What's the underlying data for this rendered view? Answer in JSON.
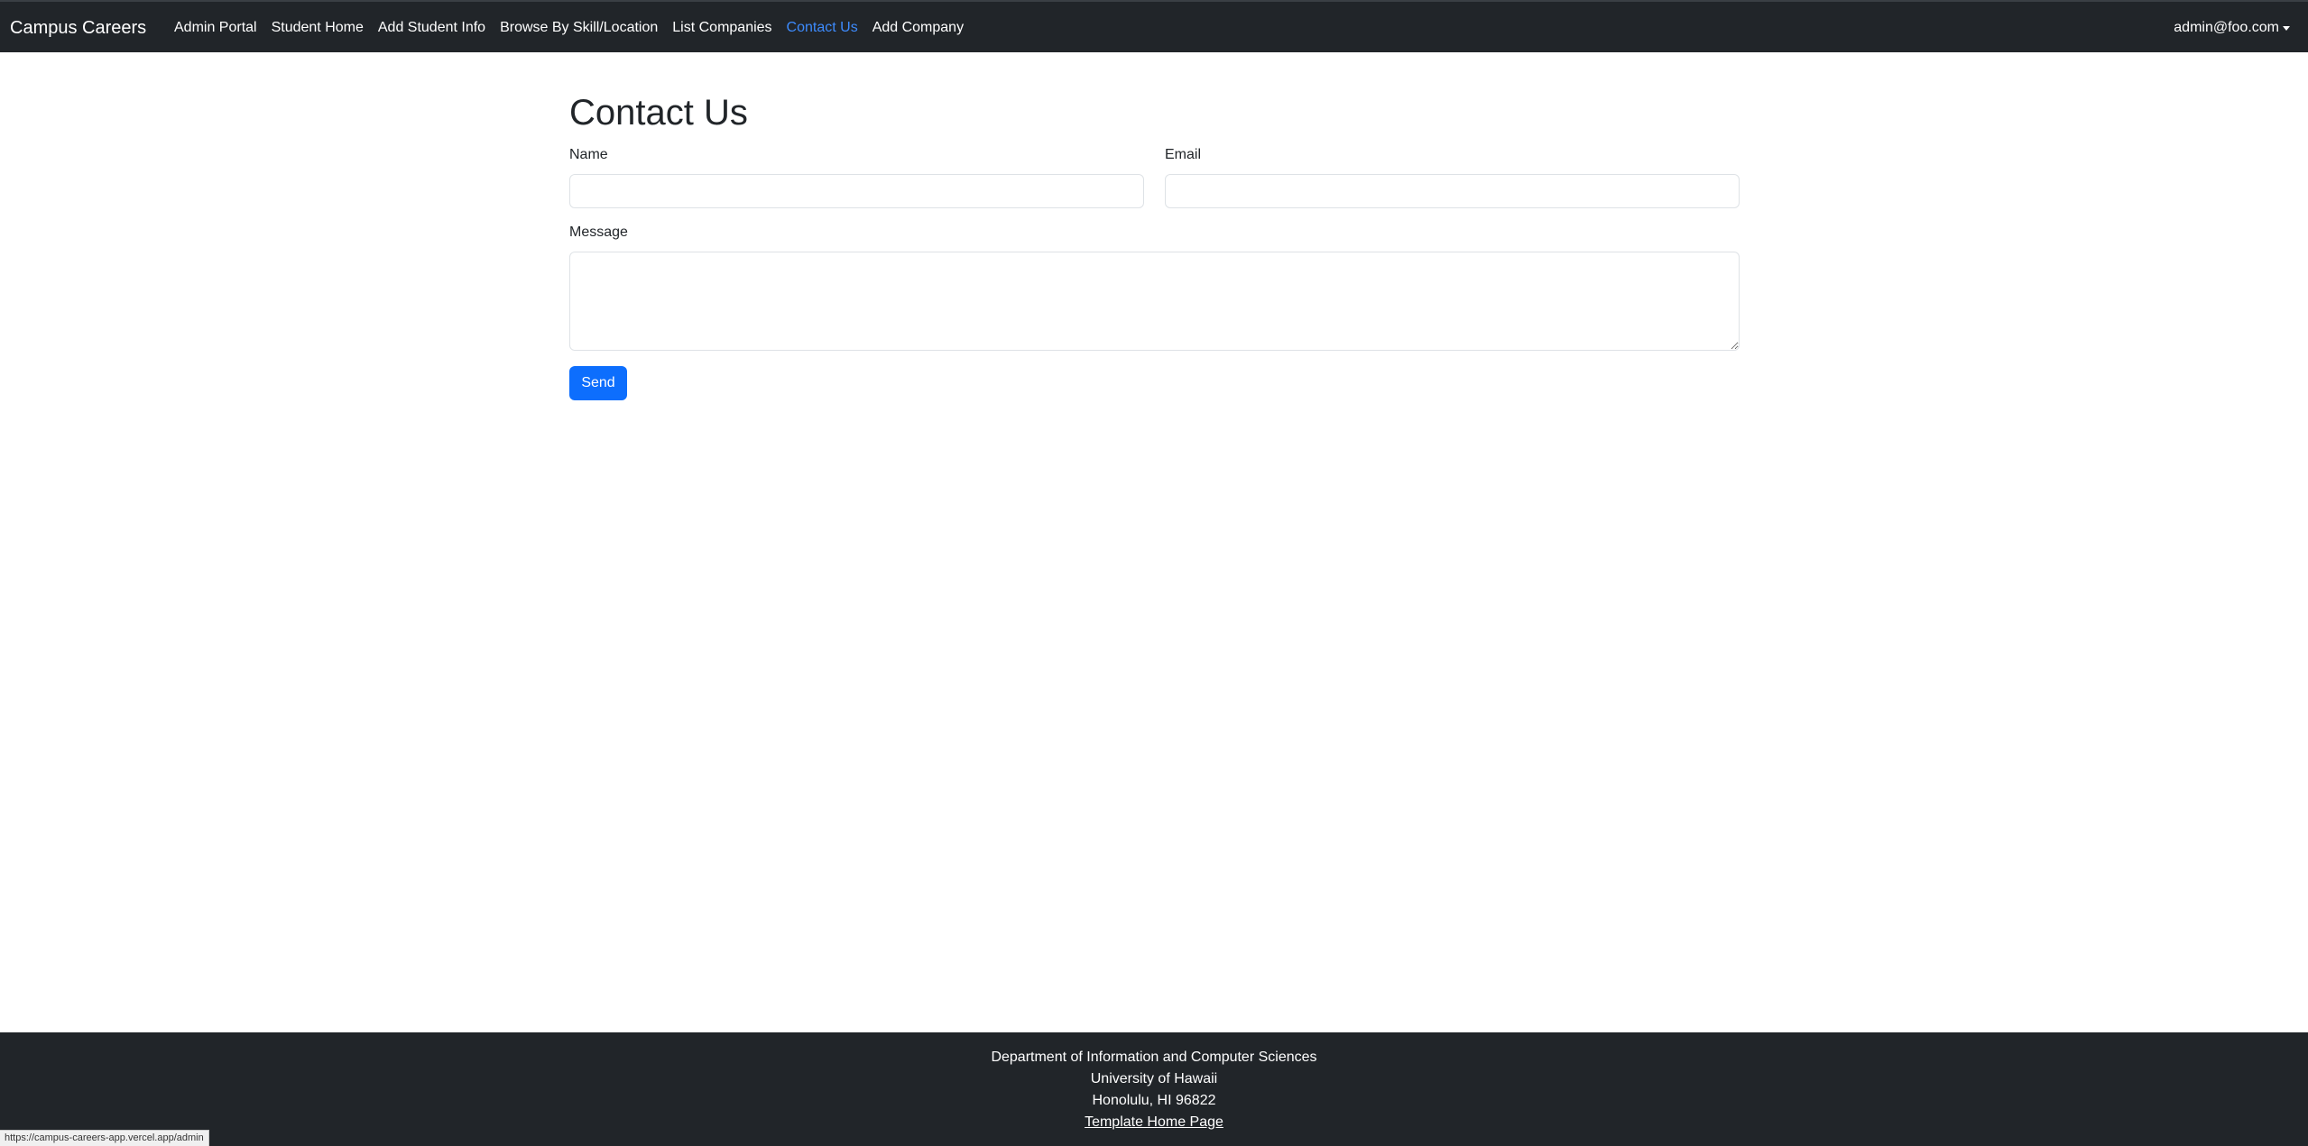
{
  "navbar": {
    "brand": "Campus Careers",
    "links": [
      {
        "label": "Admin Portal"
      },
      {
        "label": "Student Home"
      },
      {
        "label": "Add Student Info"
      },
      {
        "label": "Browse By Skill/Location"
      },
      {
        "label": "List Companies"
      },
      {
        "label": "Contact Us",
        "active": true
      },
      {
        "label": "Add Company"
      }
    ],
    "user": "admin@foo.com"
  },
  "form": {
    "title": "Contact Us",
    "name_label": "Name",
    "name_value": "",
    "email_label": "Email",
    "email_value": "",
    "message_label": "Message",
    "message_value": "",
    "send_label": "Send"
  },
  "footer": {
    "line1": "Department of Information and Computer Sciences",
    "line2": "University of Hawaii",
    "line3": "Honolulu, HI 96822",
    "link": "Template Home Page"
  },
  "status_bar": {
    "url": "https://campus-careers-app.vercel.app/admin"
  },
  "colors": {
    "navbar_bg": "#212529",
    "active_link": "#3d8bfd",
    "primary_button": "#0d6efd"
  }
}
